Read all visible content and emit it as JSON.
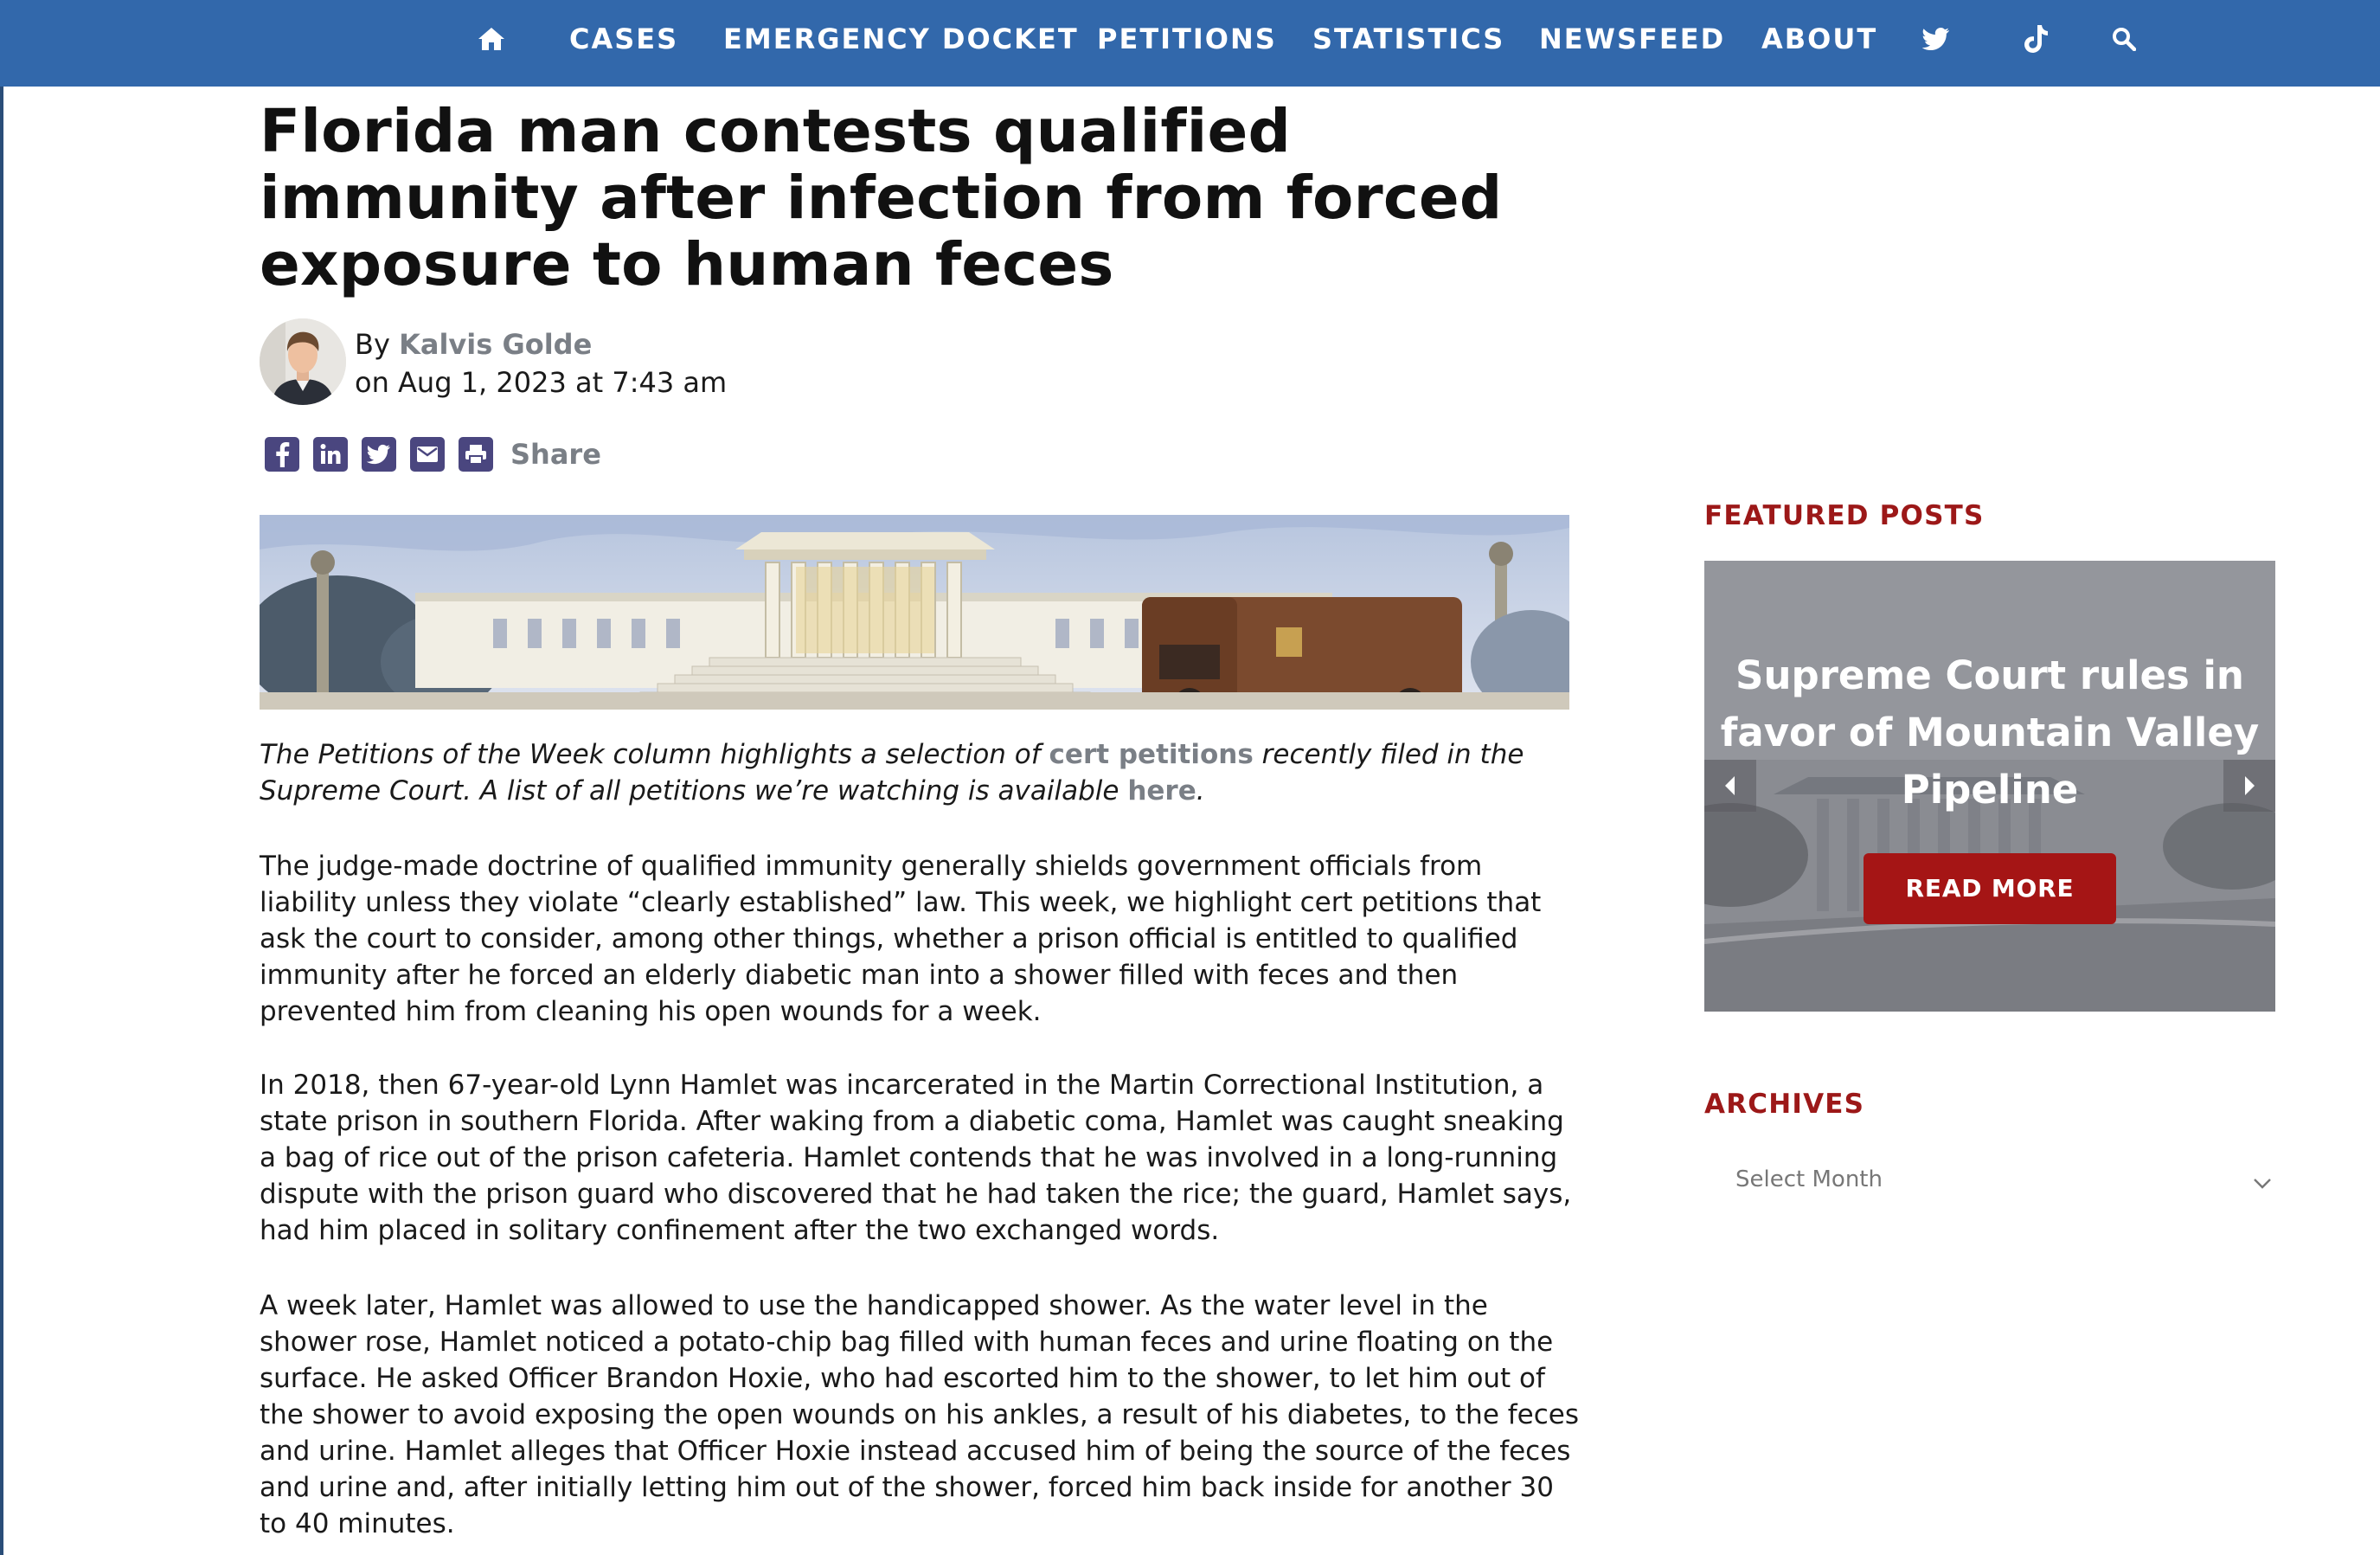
{
  "nav": {
    "home_icon": "home-icon",
    "items": [
      {
        "label": "CASES"
      },
      {
        "label": "EMERGENCY DOCKET"
      },
      {
        "label": "PETITIONS"
      },
      {
        "label": "STATISTICS"
      },
      {
        "label": "NEWSFEED"
      },
      {
        "label": "ABOUT"
      }
    ],
    "social_icons": [
      "twitter-icon",
      "tiktok-icon"
    ],
    "search_icon": "search-icon",
    "background_color": "#3268ab"
  },
  "article": {
    "title": "Florida man contests qualified immunity after infection from forced exposure to human feces",
    "byline_prefix": "By",
    "author": "Kalvis Golde",
    "date_line": "on Aug 1, 2023 at 7:43 am",
    "share_icons": [
      "facebook-icon",
      "linkedin-icon",
      "twitter-icon",
      "email-icon",
      "print-icon"
    ],
    "share_label": "Share",
    "intro": {
      "part1": "The Petitions of the Week column highlights a selection of ",
      "link1": "cert petitions",
      "part2": " recently filed in the Supreme Court. A list of all petitions we’re watching is available ",
      "link2": "here",
      "part3": "."
    },
    "paragraphs": [
      "The judge-made doctrine of qualified immunity generally shields government officials from liability unless they violate “clearly established” law. This week, we highlight cert petitions that ask the court to consider, among other things, whether a prison official is entitled to qualified immunity after he forced an elderly diabetic man into a shower filled with feces and then prevented him from cleaning his open wounds for a week.",
      "In 2018, then 67-year-old Lynn Hamlet was incarcerated in the Martin Correctional Institution, a state prison in southern Florida. After waking from a diabetic coma, Hamlet was caught sneaking a bag of rice out of the prison cafeteria. Hamlet contends that he was involved in a long-running dispute with the prison guard who discovered that he had taken the rice; the guard, Hamlet says, had him placed in solitary confinement after the two exchanged words.",
      "A week later, Hamlet was allowed to use the handicapped shower. As the water level in the shower rose, Hamlet noticed a potato-chip bag filled with human feces and urine floating on the surface. He asked Officer Brandon Hoxie, who had escorted him to the shower, to let him out of the shower to avoid exposing the open wounds on his ankles, a result of his diabetes, to the feces and urine. Hamlet alleges that Officer Hoxie instead accused him of being the source of the feces and urine and, after initially letting him out of the shower, forced him back inside for another 30 to 40 minutes."
    ]
  },
  "sidebar": {
    "featured_heading": "FEATURED POSTS",
    "featured_post": {
      "title": "Supreme Court rules in favor of Mountain Valley Pipeline",
      "button_label": "READ MORE",
      "prev_icon": "chevron-left-icon",
      "next_icon": "chevron-right-icon"
    },
    "archives_heading": "ARCHIVES",
    "archives_select": "Select Month",
    "accent_color": "#9c1818"
  }
}
